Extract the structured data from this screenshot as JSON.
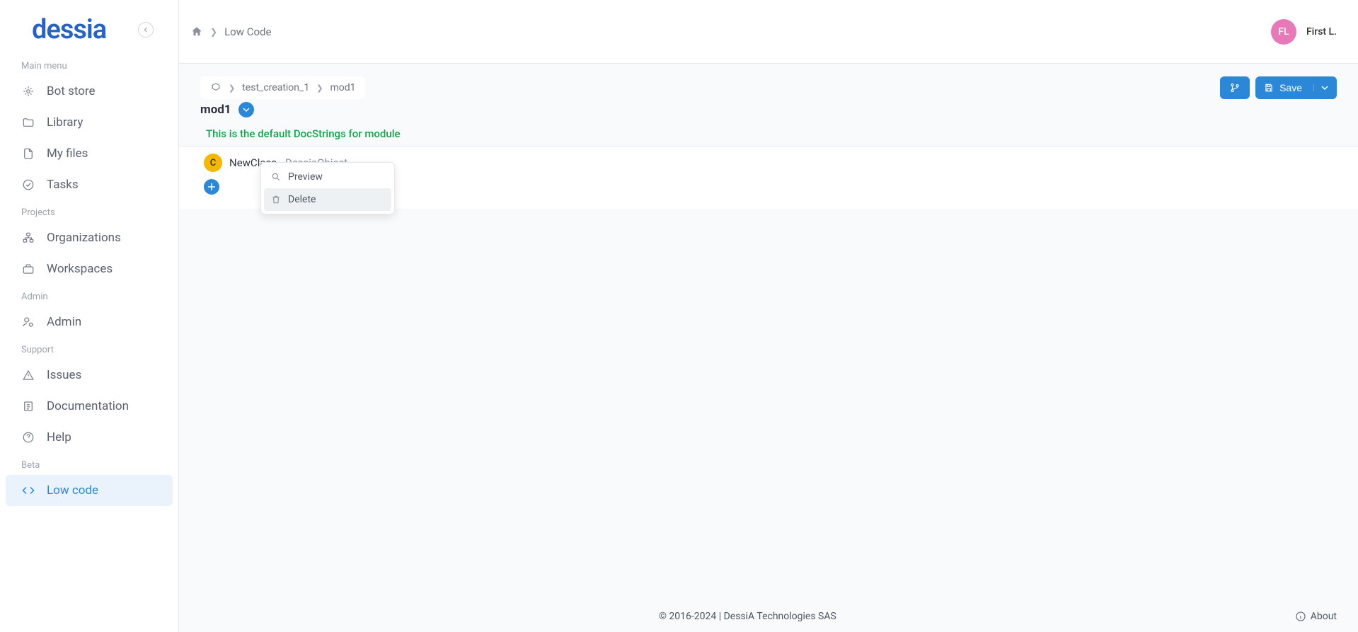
{
  "logo": "dessia",
  "topbar": {
    "home_icon": "home",
    "breadcrumb": [
      "Low Code"
    ],
    "user_initials": "FL",
    "user_name": "First L."
  },
  "sidebar": {
    "sections": [
      {
        "label": "Main menu",
        "items": [
          {
            "label": "Bot store",
            "icon": "bot"
          },
          {
            "label": "Library",
            "icon": "folder"
          },
          {
            "label": "My files",
            "icon": "file"
          },
          {
            "label": "Tasks",
            "icon": "check"
          }
        ]
      },
      {
        "label": "Projects",
        "items": [
          {
            "label": "Organizations",
            "icon": "org"
          },
          {
            "label": "Workspaces",
            "icon": "briefcase"
          }
        ]
      },
      {
        "label": "Admin",
        "items": [
          {
            "label": "Admin",
            "icon": "user-gear"
          }
        ]
      },
      {
        "label": "Support",
        "items": [
          {
            "label": "Issues",
            "icon": "alert"
          },
          {
            "label": "Documentation",
            "icon": "doc"
          },
          {
            "label": "Help",
            "icon": "question"
          }
        ]
      },
      {
        "label": "Beta",
        "items": [
          {
            "label": "Low code",
            "icon": "code",
            "active": true
          }
        ]
      }
    ]
  },
  "content": {
    "breadcrumb": [
      "test_creation_1",
      "mod1"
    ],
    "title": "mod1",
    "docstring": "This is the default DocStrings for module",
    "save_label": "Save",
    "class_row": {
      "badge": "C",
      "name": "NewClass",
      "type": "DessiaObject"
    },
    "context_menu": [
      {
        "label": "Preview",
        "icon": "search"
      },
      {
        "label": "Delete",
        "icon": "trash",
        "hover": true
      }
    ]
  },
  "footer": {
    "copyright": "© 2016-2024 | DessiA Technologies SAS",
    "about": "About"
  }
}
